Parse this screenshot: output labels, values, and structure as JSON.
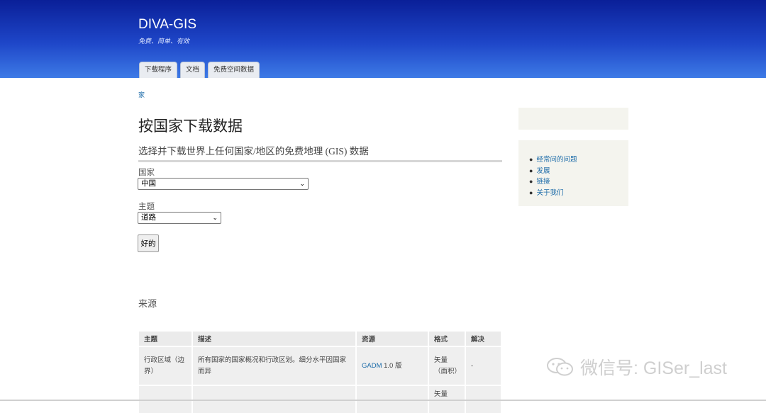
{
  "header": {
    "title": "DIVA-GIS",
    "slogan": "免费、简单、有效"
  },
  "nav": {
    "tabs": [
      "下载程序",
      "文档",
      "免费空间数据"
    ]
  },
  "breadcrumb": "家",
  "main": {
    "title": "按国家下载数据",
    "subtitle": "选择并下载世界上任何国家/地区的免费地理 (GIS) 数据",
    "country_label": "国家",
    "country_value": "中国",
    "subject_label": "主题",
    "subject_value": "道路",
    "ok_label": "好的",
    "sources_heading": "来源"
  },
  "table": {
    "headers": [
      "主题",
      "描述",
      "资源",
      "格式",
      "解决"
    ],
    "rows": [
      {
        "subject": "行政区域（边界）",
        "description": "所有国家的国家概况和行政区划。细分水平因国家而异",
        "source_link": "GADM",
        "source_suffix": " 1.0 版",
        "format": "矢量（面积）",
        "resolution": "-"
      },
      {
        "subject": "",
        "description": "",
        "source_link": "",
        "source_suffix": "",
        "format": "矢量",
        "resolution": ""
      }
    ]
  },
  "sidebar": {
    "links": [
      "经常问的问题",
      "发展",
      "链接",
      "关于我们"
    ]
  },
  "watermark": "微信号: GISer_last"
}
